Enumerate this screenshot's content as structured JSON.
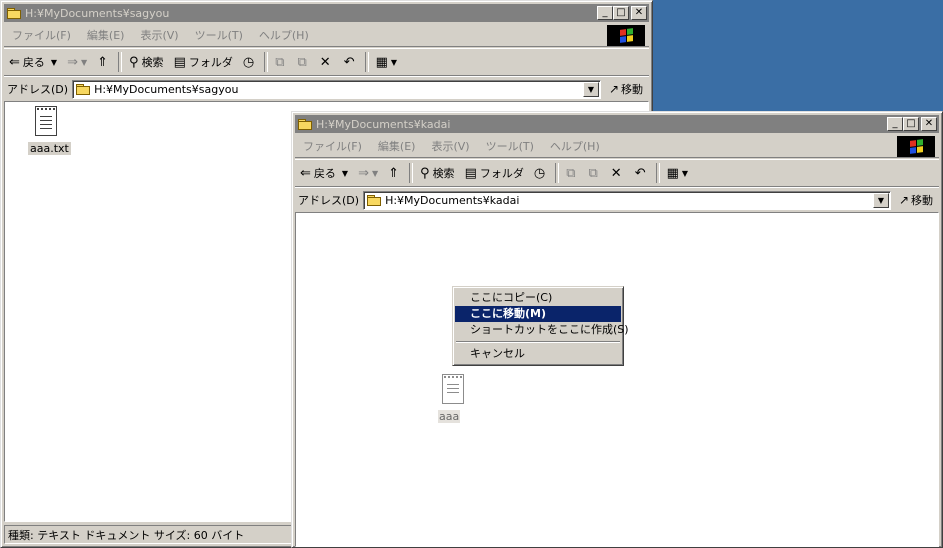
{
  "colors": {
    "desktop": "#3a6ea5",
    "titlebar_inactive": "#808080",
    "selection": "#0a246a"
  },
  "back_window": {
    "title": "H:¥MyDocuments¥sagyou",
    "menu": [
      "ファイル(F)",
      "編集(E)",
      "表示(V)",
      "ツール(T)",
      "ヘルプ(H)"
    ],
    "toolbar": {
      "back": "戻る",
      "search": "検索",
      "folders": "フォルダ"
    },
    "address_label": "アドレス(D)",
    "address_value": "H:¥MyDocuments¥sagyou",
    "go_label": "移動",
    "file_label": "aaa.txt",
    "status": "種類: テキスト ドキュメント サイズ: 60 バイト"
  },
  "front_window": {
    "title": "H:¥MyDocuments¥kadai",
    "menu": [
      "ファイル(F)",
      "編集(E)",
      "表示(V)",
      "ツール(T)",
      "ヘルプ(H)"
    ],
    "toolbar": {
      "back": "戻る",
      "search": "検索",
      "folders": "フォルダ"
    },
    "address_label": "アドレス(D)",
    "address_value": "H:¥MyDocuments¥kadai",
    "go_label": "移動",
    "file_label_partial": "aaa"
  },
  "context_menu": {
    "items": [
      "ここにコピー(C)",
      "ここに移動(M)",
      "ショートカットをここに作成(S)",
      "キャンセル"
    ]
  },
  "icons": [
    "folder-icon",
    "windows-logo-icon",
    "back-arrow-icon",
    "forward-arrow-icon",
    "up-folder-icon",
    "search-icon",
    "folders-icon",
    "history-icon",
    "move-to-icon",
    "copy-to-icon",
    "delete-icon",
    "undo-icon",
    "views-icon",
    "go-arrow-icon",
    "text-file-icon"
  ]
}
